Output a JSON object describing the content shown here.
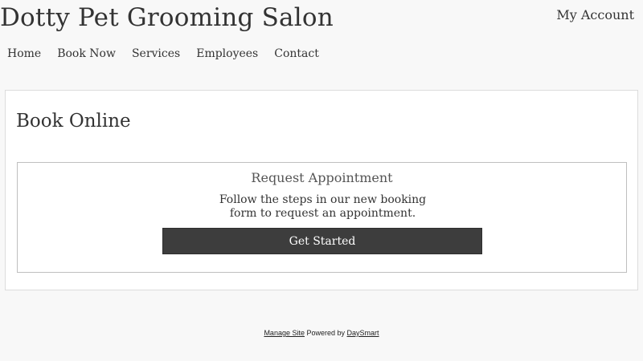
{
  "header": {
    "site_title": "Dotty Pet Grooming Salon",
    "account_label": "My Account"
  },
  "nav": {
    "items": [
      {
        "label": "Home"
      },
      {
        "label": "Book Now"
      },
      {
        "label": "Services"
      },
      {
        "label": "Employees"
      },
      {
        "label": "Contact"
      }
    ]
  },
  "main": {
    "title": "Book Online",
    "card": {
      "title": "Request Appointment",
      "description": "Follow the steps in our new booking form to request an appointment.",
      "button_label": "Get Started"
    }
  },
  "footer": {
    "manage_site": "Manage Site",
    "powered_by": "Powered by",
    "vendor": "DaySmart"
  },
  "colors": {
    "background": "#f8f8f8",
    "button": "#3d3d3d",
    "text": "#333333"
  }
}
